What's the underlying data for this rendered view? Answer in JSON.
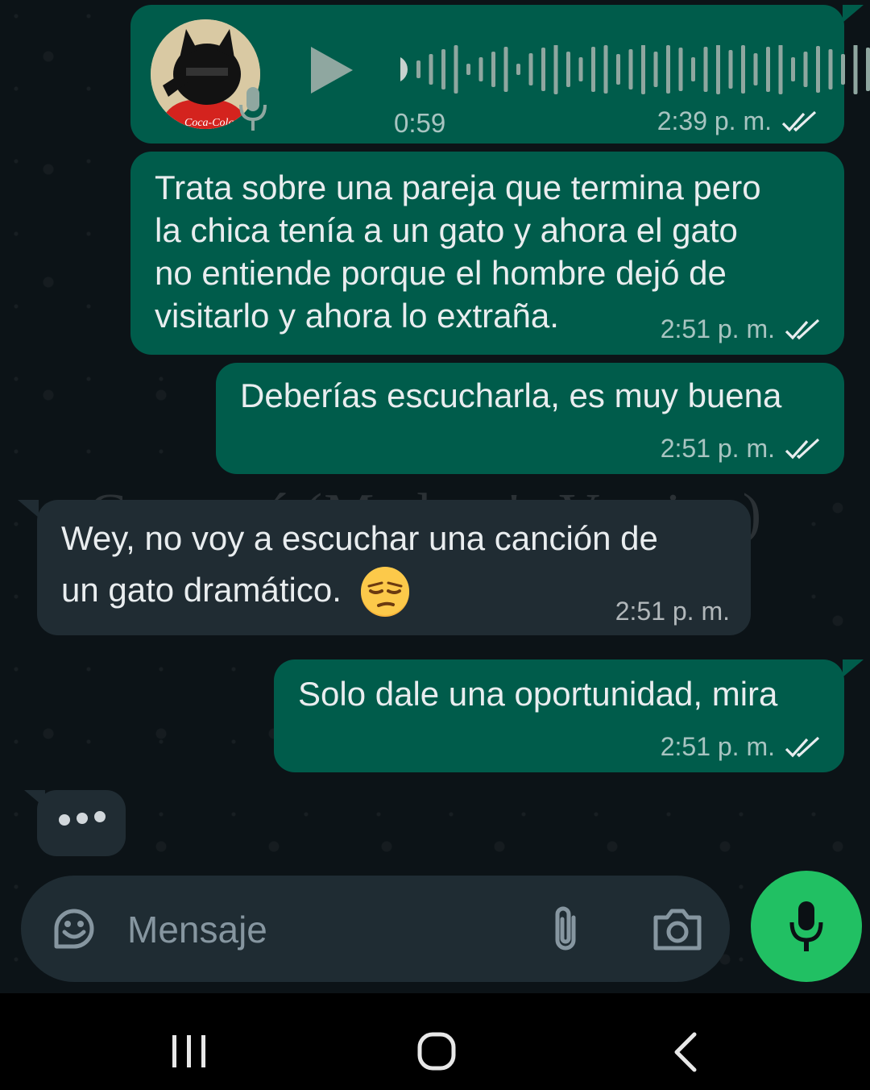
{
  "colors": {
    "outgoing_bubble": "#005c4b",
    "incoming_bubble": "#202c33",
    "accent_green": "#21c063",
    "chat_background": "#0c1317",
    "meta_text": "#a7b0b5",
    "read_ticks": "#e9edef"
  },
  "watermark": "Carmesí (Madero's Version)",
  "messages": [
    {
      "type": "voice-note",
      "direction": "outgoing",
      "duration": "0:59",
      "time": "2:39 p. m.",
      "status_icon": "double-check-icon",
      "icons": [
        "play-icon",
        "microphone-icon",
        "avatar-cat-photo"
      ]
    },
    {
      "type": "text",
      "direction": "outgoing",
      "lines": [
        "Trata sobre una pareja que termina pero",
        "la chica tenía a un gato y ahora el gato",
        "no entiende porque el hombre dejó de",
        "visitarlo y ahora lo extraña."
      ],
      "time": "2:51 p. m.",
      "status_icon": "double-check-icon"
    },
    {
      "type": "text",
      "direction": "outgoing",
      "text": "Deberías escucharla, es muy buena",
      "time": "2:51 p. m.",
      "status_icon": "double-check-icon"
    },
    {
      "type": "text",
      "direction": "incoming",
      "lines": [
        "Wey, no voy a escuchar una canción de",
        "un gato dramático."
      ],
      "emoji": "😒",
      "time": "2:51 p. m."
    },
    {
      "type": "text",
      "direction": "outgoing",
      "text": "Solo dale una oportunidad, mira",
      "time": "2:51 p. m.",
      "status_icon": "double-check-icon"
    }
  ],
  "typing_indicator": {
    "icon": "typing-dots-icon"
  },
  "composer": {
    "placeholder": "Mensaje",
    "icons": [
      "sticker-icon",
      "paperclip-icon",
      "camera-icon"
    ],
    "send_button_icon": "microphone-icon"
  },
  "navbar": {
    "icons": [
      "recent-apps-icon",
      "home-icon",
      "back-icon"
    ]
  }
}
